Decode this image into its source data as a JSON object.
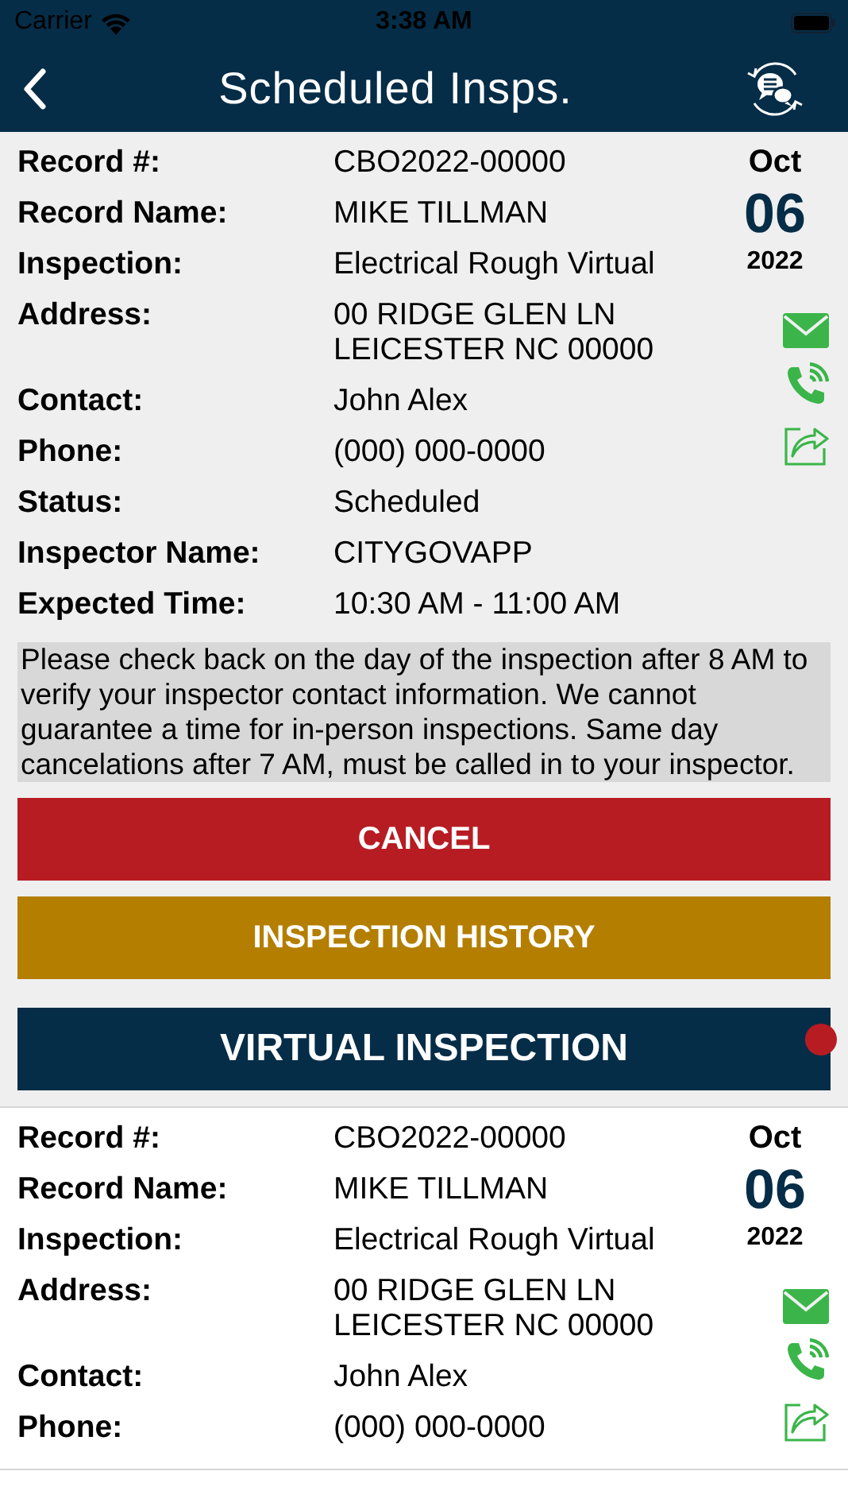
{
  "status_bar": {
    "carrier": "Carrier",
    "time": "3:38 AM"
  },
  "nav": {
    "title": "Scheduled Insps."
  },
  "cards": [
    {
      "selected": true,
      "date": {
        "month": "Oct",
        "day": "06",
        "year": "2022"
      },
      "fields": [
        {
          "label": "Record #:",
          "lines": [
            "CBO2022-00000"
          ]
        },
        {
          "label": "Record Name:",
          "lines": [
            "MIKE TILLMAN"
          ]
        },
        {
          "label": "Inspection:",
          "lines": [
            "Electrical Rough Virtual"
          ]
        },
        {
          "label": "Address:",
          "lines": [
            "00 RIDGE GLEN LN",
            "LEICESTER NC 00000"
          ]
        },
        {
          "label": "Contact:",
          "lines": [
            "John Alex"
          ]
        },
        {
          "label": "Phone:",
          "lines": [
            "(000) 000-0000"
          ]
        },
        {
          "label": "Status:",
          "lines": [
            "Scheduled"
          ]
        },
        {
          "label": "Inspector Name:",
          "lines": [
            "CITYGOVAPP"
          ]
        },
        {
          "label": "Expected Time:",
          "lines": [
            "10:30 AM - 11:00 AM"
          ]
        }
      ],
      "notice": "Please check back on the day of the inspection after 8 AM to verify your inspector contact information.  We cannot guarantee a time for in-person inspections. Same day cancelations after 7 AM, must be called in to your inspector.",
      "buttons": [
        {
          "kind": "cancel",
          "label": "CANCEL",
          "badge": false
        },
        {
          "kind": "history",
          "label": "INSPECTION HISTORY",
          "badge": false
        },
        {
          "kind": "virtual",
          "label": "VIRTUAL INSPECTION",
          "badge": true
        }
      ]
    },
    {
      "selected": false,
      "date": {
        "month": "Oct",
        "day": "06",
        "year": "2022"
      },
      "fields": [
        {
          "label": "Record #:",
          "lines": [
            "CBO2022-00000"
          ]
        },
        {
          "label": "Record Name:",
          "lines": [
            "MIKE TILLMAN"
          ]
        },
        {
          "label": "Inspection:",
          "lines": [
            "Electrical Rough Virtual"
          ]
        },
        {
          "label": "Address:",
          "lines": [
            "00 RIDGE GLEN LN",
            "LEICESTER NC 00000"
          ]
        },
        {
          "label": "Contact:",
          "lines": [
            "John Alex"
          ]
        },
        {
          "label": "Phone:",
          "lines": [
            "(000) 000-0000"
          ]
        }
      ]
    }
  ]
}
